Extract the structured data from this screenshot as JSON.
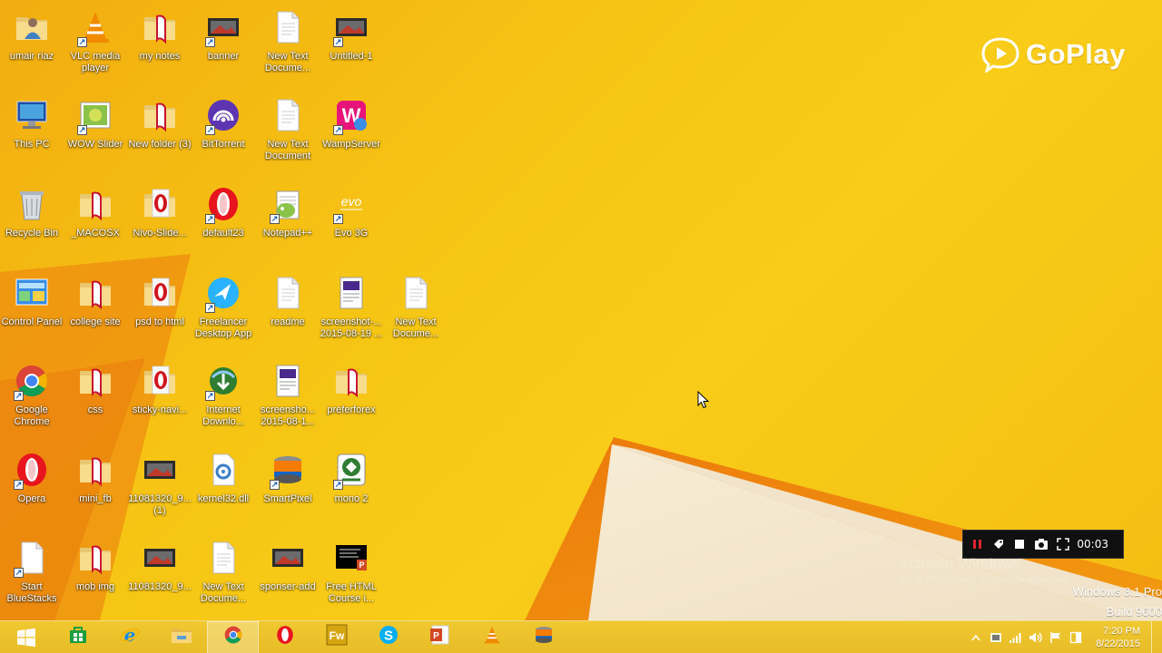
{
  "desktop": {
    "icons": [
      {
        "label": "umair riaz",
        "icon": "user-folder-icon"
      },
      {
        "label": "VLC media player",
        "icon": "vlc-icon"
      },
      {
        "label": "my notes",
        "icon": "folder-icon"
      },
      {
        "label": "banner",
        "icon": "image-file-icon"
      },
      {
        "label": "New Text Docume...",
        "icon": "text-document-icon"
      },
      {
        "label": "Untitled-1",
        "icon": "image-file-icon"
      },
      {
        "label": "This PC",
        "icon": "computer-icon"
      },
      {
        "label": "WOW Slider",
        "icon": "wow-slider-icon"
      },
      {
        "label": "New folder (3)",
        "icon": "folder-icon"
      },
      {
        "label": "BitTorrent",
        "icon": "bittorrent-icon"
      },
      {
        "label": "New Text Document",
        "icon": "text-document-icon"
      },
      {
        "label": "WampServer",
        "icon": "wampserver-icon"
      },
      {
        "label": "Recycle Bin",
        "icon": "recycle-bin-icon"
      },
      {
        "label": "_MACOSX",
        "icon": "folder-icon"
      },
      {
        "label": "Nivo-Slide...",
        "icon": "opera-html-icon"
      },
      {
        "label": "default23",
        "icon": "opera-icon"
      },
      {
        "label": "Notepad++",
        "icon": "notepad-plus-plus-icon"
      },
      {
        "label": "Evo 3G",
        "icon": "evo-3g-icon"
      },
      {
        "label": "Control Panel",
        "icon": "control-panel-icon"
      },
      {
        "label": "college site",
        "icon": "folder-icon"
      },
      {
        "label": "psd to html",
        "icon": "opera-html-icon"
      },
      {
        "label": "Freelancer Desktop App",
        "icon": "freelancer-icon"
      },
      {
        "label": "readme",
        "icon": "text-document-icon"
      },
      {
        "label": "screenshot-... 2015-08-19 ...",
        "icon": "screenshot-file-icon"
      },
      {
        "label": "New Text Docume...",
        "icon": "text-document-icon"
      },
      {
        "label": "Google Chrome",
        "icon": "chrome-icon"
      },
      {
        "label": "css",
        "icon": "folder-icon"
      },
      {
        "label": "sticky-navi...",
        "icon": "opera-html-icon"
      },
      {
        "label": "Internet Downlo...",
        "icon": "internet-download-manager-icon"
      },
      {
        "label": "screensho... 2015-08-1...",
        "icon": "screenshot-file-icon"
      },
      {
        "label": "preferforex",
        "icon": "folder-icon"
      },
      {
        "label": "Opera",
        "icon": "opera-icon"
      },
      {
        "label": "mini_fb",
        "icon": "folder-icon"
      },
      {
        "label": "11081320_9... (1)",
        "icon": "image-file-icon"
      },
      {
        "label": "kernel32.dll",
        "icon": "dll-file-icon"
      },
      {
        "label": "SmartPixel",
        "icon": "smartpixel-icon"
      },
      {
        "label": "mono 2",
        "icon": "mono-icon"
      },
      {
        "label": "Start BlueStacks",
        "icon": "document-icon"
      },
      {
        "label": "mob img",
        "icon": "folder-icon"
      },
      {
        "label": "11081320_9...",
        "icon": "image-file-icon"
      },
      {
        "label": "New Text Docume...",
        "icon": "text-document-icon"
      },
      {
        "label": "sponser-add",
        "icon": "image-file-icon"
      },
      {
        "label": "Free HTML Course i...",
        "icon": "powerpoint-file-icon"
      }
    ]
  },
  "goplay": {
    "label": "GoPlay"
  },
  "recorder": {
    "time": "00:03"
  },
  "watermark": {
    "title": "Activate Windows",
    "subtitle": "Go to PC settings to activate Windows."
  },
  "system": {
    "edition": "Windows 8.1 Pro",
    "build": "Build 9600"
  },
  "taskbar": {
    "start": "windows-start-icon",
    "apps": [
      {
        "name": "store",
        "icon": "windows-store-icon"
      },
      {
        "name": "internet-explorer",
        "icon": "internet-explorer-icon"
      },
      {
        "name": "file-explorer",
        "icon": "file-explorer-icon"
      },
      {
        "name": "chrome",
        "icon": "chrome-icon",
        "active": true
      },
      {
        "name": "opera",
        "icon": "opera-icon"
      },
      {
        "name": "fireworks",
        "icon": "fireworks-icon",
        "text": "Fw"
      },
      {
        "name": "skype",
        "icon": "skype-icon"
      },
      {
        "name": "powerpoint",
        "icon": "powerpoint-icon"
      },
      {
        "name": "vlc",
        "icon": "vlc-icon"
      },
      {
        "name": "smartpixel",
        "icon": "smartpixel-icon"
      }
    ],
    "clock": {
      "time": "7:20 PM",
      "date": "8/22/2015"
    }
  },
  "colors": {
    "wallpaper": "#f6c414",
    "taskbar": "#edc22c",
    "recorder": "#101010",
    "rec_red": "#d9262b"
  }
}
